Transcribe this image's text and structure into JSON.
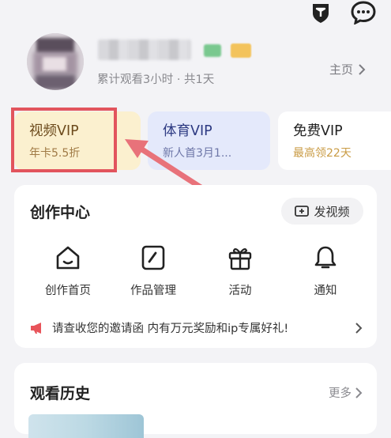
{
  "header": {
    "icons": [
      "shield-icon",
      "message-icon"
    ]
  },
  "profile": {
    "watch_stats": "累计观看3小时 · 共1天",
    "home_link": "主页"
  },
  "vip_cards": [
    {
      "title": "视频VIP",
      "subtitle": "年卡5.5折",
      "color": "#fbf0cf"
    },
    {
      "title": "体育VIP",
      "subtitle": "新人首3月1...",
      "color": "#e4e9fb"
    },
    {
      "title": "免费VIP",
      "subtitle": "最高领22天",
      "color": "#ffffff"
    }
  ],
  "creation": {
    "title": "创作中心",
    "upload_label": "发视频",
    "tools": [
      {
        "label": "创作首页",
        "icon": "home-icon"
      },
      {
        "label": "作品管理",
        "icon": "edit-icon"
      },
      {
        "label": "活动",
        "icon": "gift-icon"
      },
      {
        "label": "通知",
        "icon": "bell-icon"
      }
    ],
    "invite_text": "请查收您的邀请函 内有万元奖励和ip专属好礼!"
  },
  "history": {
    "title": "观看历史",
    "more_label": "更多"
  },
  "colors": {
    "highlight": "#e2545d",
    "arrow": "#e8727a",
    "megaphone": "#e8545a"
  }
}
